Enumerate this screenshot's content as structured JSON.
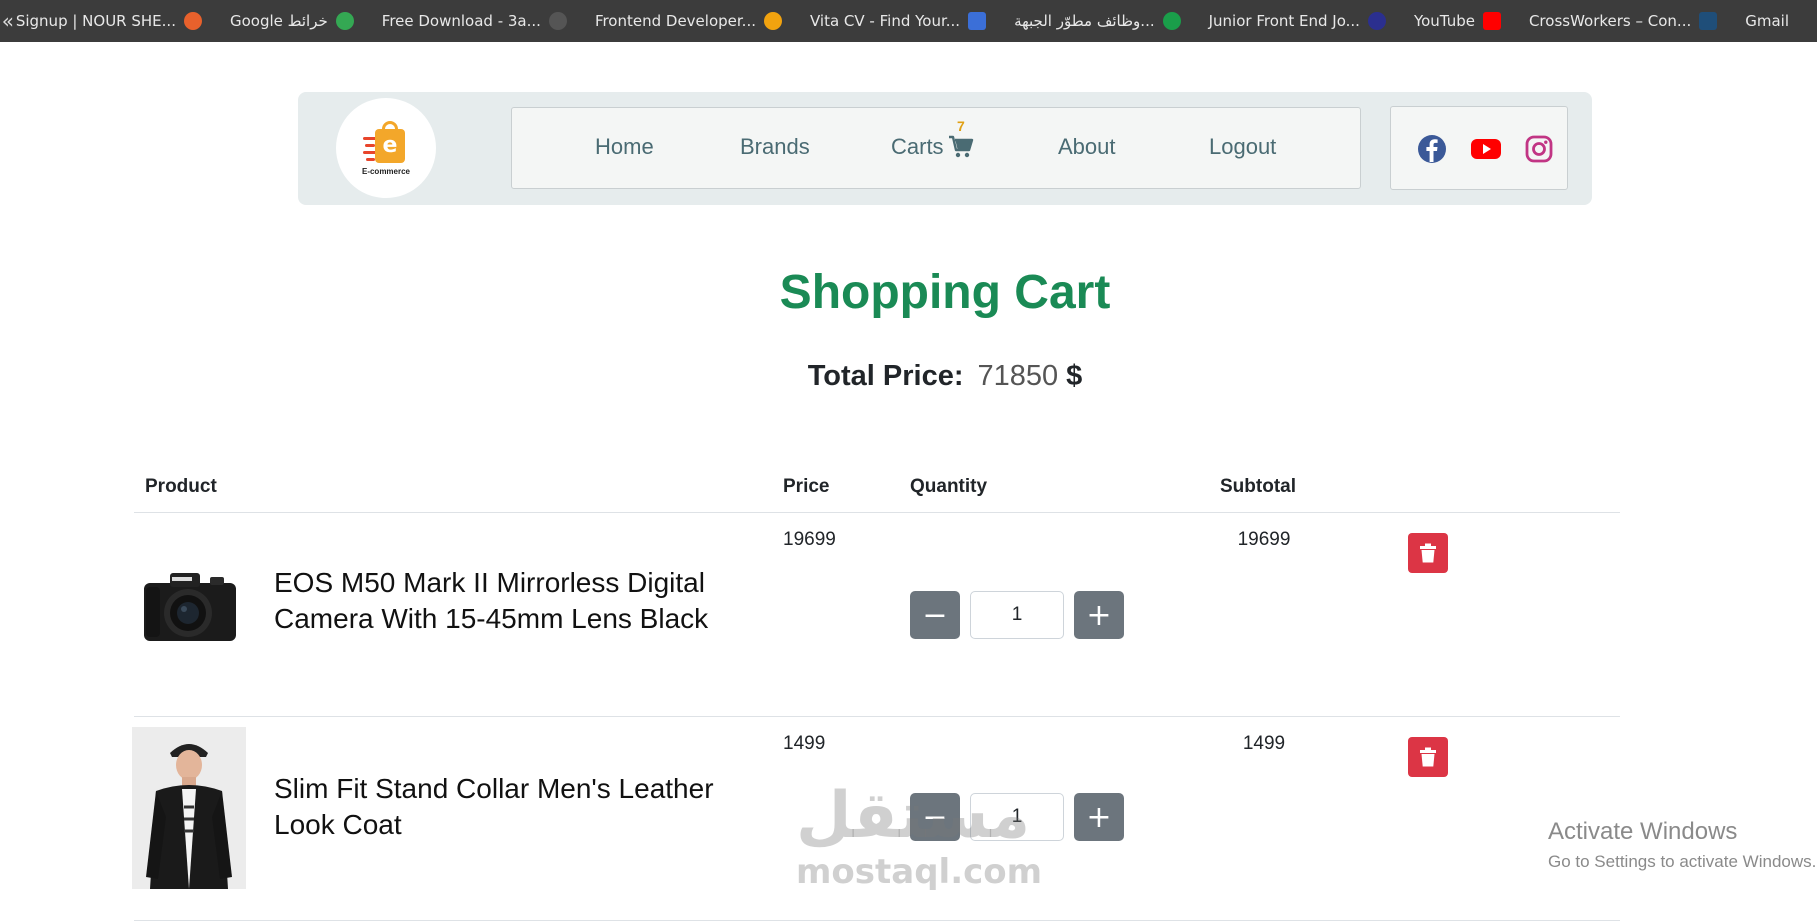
{
  "bookmarks": {
    "collapse_glyph": "«",
    "items": [
      {
        "label": "Signup | NOUR SHE...",
        "icon": "circle-orange-icon",
        "color": "#e8612c"
      },
      {
        "label": "Google خرائط",
        "icon": "maps-pin-icon",
        "color": "#34a853"
      },
      {
        "label": "Free Download - 3a...",
        "icon": "dark-circle-icon",
        "color": "#555555"
      },
      {
        "label": "Frontend Developer...",
        "icon": "star-orange-icon",
        "color": "#f2a30f"
      },
      {
        "label": "Vita CV - Find Your...",
        "icon": "vita-icon",
        "color": "#3b6fd8"
      },
      {
        "label": "وظائف مطوّر الجبهة...",
        "icon": "green-logo-icon",
        "color": "#1a9e4a"
      },
      {
        "label": "Junior Front End Jo...",
        "icon": "navy-logo-icon",
        "color": "#2b2f8f"
      },
      {
        "label": "YouTube",
        "icon": "youtube-icon",
        "color": "#ff0000"
      },
      {
        "label": "CrossWorkers – Con...",
        "icon": "crossworkers-icon",
        "color": "#1f4e79"
      },
      {
        "label": "Gmail",
        "icon": "gmail-icon",
        "color": "#ea4335"
      }
    ]
  },
  "nav": {
    "logo_text": "E-commerce",
    "logo_letter": "e",
    "links": {
      "home": "Home",
      "brands": "Brands",
      "carts": "Carts",
      "about": "About",
      "logout": "Logout"
    },
    "cart_count": "7",
    "social": [
      "facebook-icon",
      "youtube-icon",
      "instagram-icon"
    ]
  },
  "page": {
    "title": "Shopping Cart",
    "total_label": "Total Price:",
    "total_value": "71850",
    "currency": "$"
  },
  "table": {
    "headers": {
      "product": "Product",
      "price": "Price",
      "quantity": "Quantity",
      "subtotal": "Subtotal"
    },
    "rows": [
      {
        "name": "EOS M50 Mark II Mirrorless Digital Camera With 15-45mm Lens Black",
        "price": "19699",
        "quantity": "1",
        "subtotal": "19699",
        "image": "camera"
      },
      {
        "name": "Slim Fit Stand Collar Men's Leather Look Coat",
        "price": "1499",
        "quantity": "1",
        "subtotal": "1499",
        "image": "coat"
      }
    ],
    "minus_label": "−",
    "plus_label": "+"
  },
  "overlays": {
    "watermark_ar": "مستقل",
    "watermark_en": "mostaql.com",
    "activate_title": "Activate Windows",
    "activate_sub": "Go to Settings to activate Windows."
  },
  "colors": {
    "title_green": "#1a8a55",
    "nav_link": "#4a6b73",
    "qty_button": "#6c757d",
    "delete_red": "#dc3545",
    "badge_orange": "#e0a014"
  }
}
